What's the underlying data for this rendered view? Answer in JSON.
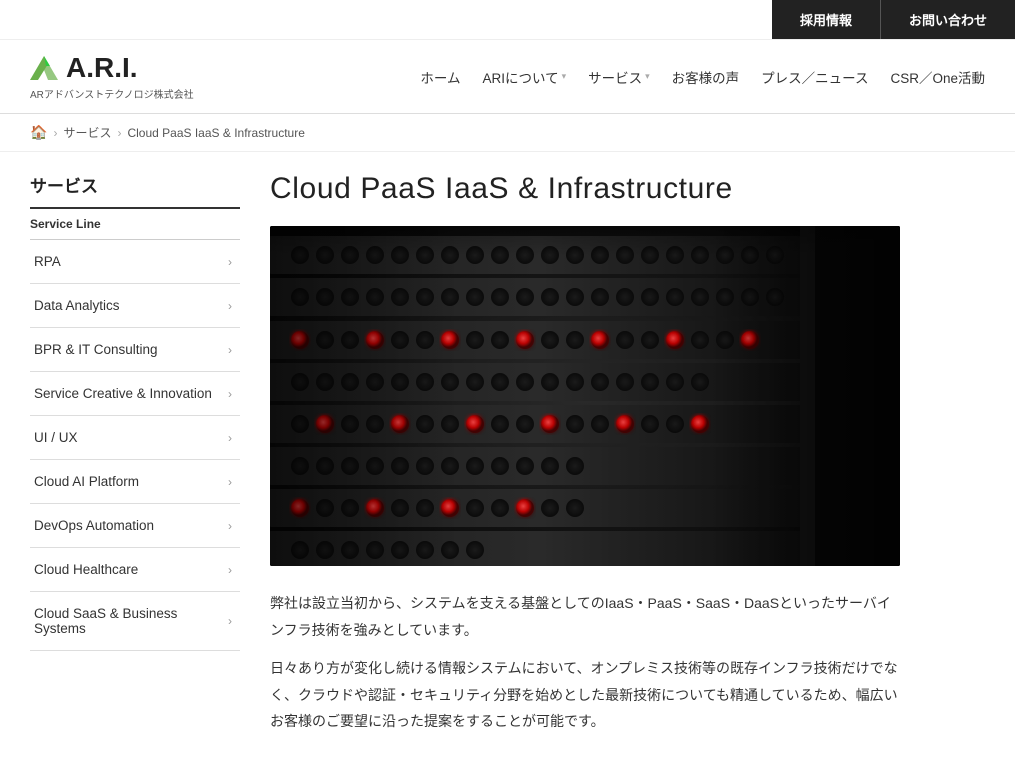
{
  "topbar": {
    "recruit_label": "採用情報",
    "contact_label": "お問い合わせ"
  },
  "header": {
    "logo_main": "A.R.I.",
    "logo_subtitle": "ARアドバンストテクノロジ株式会社",
    "nav": [
      {
        "label": "ホーム",
        "has_chevron": false
      },
      {
        "label": "ARIについて",
        "has_chevron": true
      },
      {
        "label": "サービス",
        "has_chevron": true
      },
      {
        "label": "お客様の声",
        "has_chevron": false
      },
      {
        "label": "プレス／ニュース",
        "has_chevron": false
      },
      {
        "label": "CSR／One活動",
        "has_chevron": false
      }
    ]
  },
  "breadcrumb": {
    "home_label": "🏠",
    "items": [
      "サービス",
      "Cloud PaaS IaaS & Infrastructure"
    ]
  },
  "sidebar": {
    "title": "サービス",
    "section_title": "Service Line",
    "items": [
      "RPA",
      "Data Analytics",
      "BPR & IT Consulting",
      "Service Creative & Innovation",
      "UI / UX",
      "Cloud AI Platform",
      "DevOps Automation",
      "Cloud Healthcare",
      "Cloud SaaS & Business Systems"
    ]
  },
  "content": {
    "page_title": "Cloud PaaS IaaS & Infrastructure",
    "body_paragraph1": "弊社は設立当初から、システムを支える基盤としてのIaaS・PaaS・SaaS・DaaSといったサーバインフラ技術を強みとしています。",
    "body_paragraph2": "日々あり方が変化し続ける情報システムにおいて、オンプレミス技術等の既存インフラ技術だけでなく、クラウドや認証・セキュリティ分野を始めとした最新技術についても精通しているため、幅広いお客様のご要望に沿った提案をすることが可能です。"
  }
}
